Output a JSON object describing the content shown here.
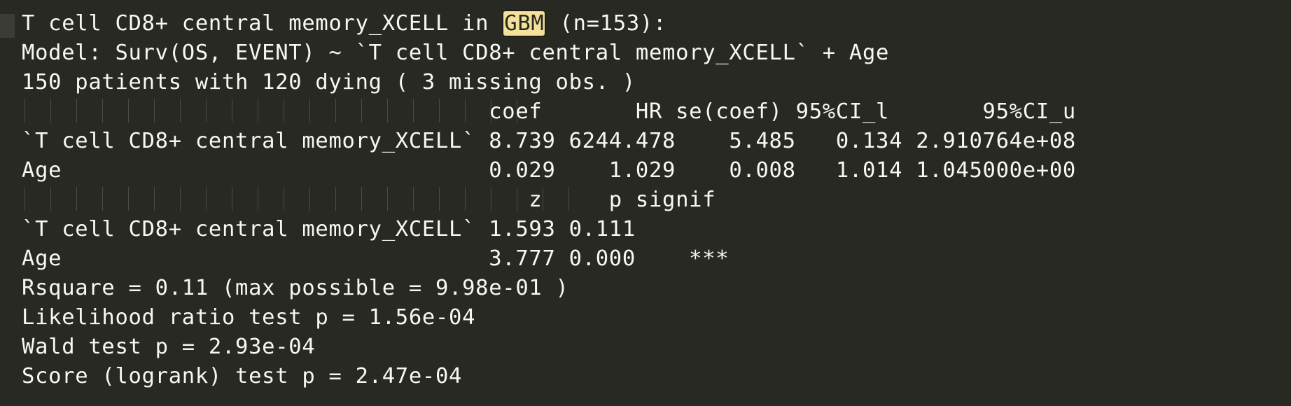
{
  "console": {
    "header": {
      "before": "T cell CD8+ central memory_XCELL in ",
      "highlight": "GBM",
      "after": " (n=153):"
    },
    "model_line": "Model: Surv(OS, EVENT) ~ `T cell CD8+ central memory_XCELL` + Age",
    "patients_line": "150 patients with 120 dying ( 3 missing obs. )",
    "table1": {
      "header": "                                   coef       HR se(coef) 95%CI_l       95%CI_u",
      "rows": [
        "`T cell CD8+ central memory_XCELL` 8.739 6244.478    5.485   0.134 2.910764e+08",
        "Age                                0.029    1.029    0.008   1.014 1.045000e+00"
      ]
    },
    "table2": {
      "header": "                                      z     p signif",
      "rows": [
        "`T cell CD8+ central memory_XCELL` 1.593 0.111",
        "Age                                3.777 0.000    ***"
      ]
    },
    "stats": [
      "Rsquare = 0.11 (max possible = 9.98e-01 )",
      "Likelihood ratio test p = 1.56e-04",
      "Wald test p = 2.93e-04",
      "Score (logrank) test p = 2.47e-04"
    ]
  }
}
